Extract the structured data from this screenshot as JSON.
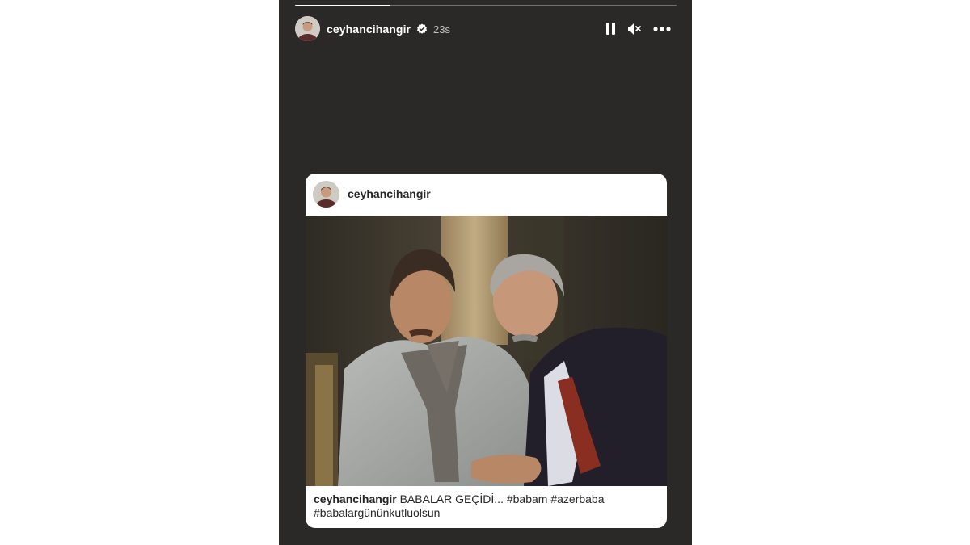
{
  "story": {
    "progress": 0.25,
    "username": "ceyhancihangir",
    "time": "23s",
    "verified": true,
    "controls": {
      "pause_icon": "pause-icon",
      "mute_icon": "speaker-muted-icon",
      "more_icon": "more-horizontal-icon"
    }
  },
  "post": {
    "username": "ceyhancihangir",
    "caption_user": "ceyhancihangir",
    "caption_text": "BABALAR GEÇİDİ... #babam #azerbaba",
    "caption_text2": "#babalargününkutluolsun"
  },
  "colors": {
    "story_bg": "#2b2927",
    "card_bg": "#ffffff",
    "verified_badge": "#ffffff"
  }
}
